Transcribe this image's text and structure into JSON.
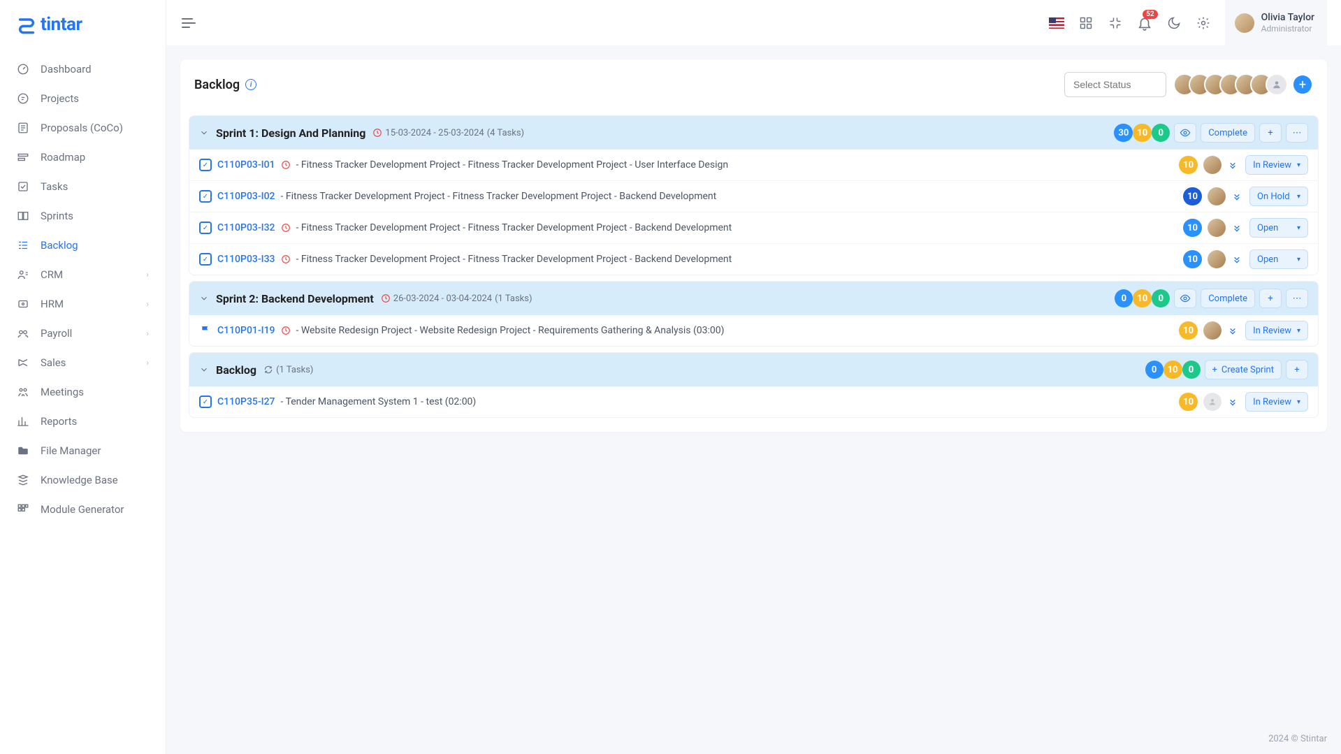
{
  "brand": "tintar",
  "user": {
    "name": "Olivia Taylor",
    "role": "Administrator"
  },
  "notif_count": "52",
  "page": {
    "title": "Backlog",
    "status_placeholder": "Select Status"
  },
  "sidebar": [
    {
      "label": "Dashboard",
      "icon": "gauge"
    },
    {
      "label": "Projects",
      "icon": "project"
    },
    {
      "label": "Proposals (CoCo)",
      "icon": "proposal"
    },
    {
      "label": "Roadmap",
      "icon": "roadmap"
    },
    {
      "label": "Tasks",
      "icon": "tasks"
    },
    {
      "label": "Sprints",
      "icon": "sprints"
    },
    {
      "label": "Backlog",
      "icon": "backlog",
      "active": true
    },
    {
      "label": "CRM",
      "icon": "crm",
      "expandable": true
    },
    {
      "label": "HRM",
      "icon": "hrm",
      "expandable": true
    },
    {
      "label": "Payroll",
      "icon": "payroll",
      "expandable": true
    },
    {
      "label": "Sales",
      "icon": "sales",
      "expandable": true
    },
    {
      "label": "Meetings",
      "icon": "meetings"
    },
    {
      "label": "Reports",
      "icon": "reports"
    },
    {
      "label": "File Manager",
      "icon": "filemgr"
    },
    {
      "label": "Knowledge Base",
      "icon": "kb"
    },
    {
      "label": "Module Generator",
      "icon": "modgen"
    }
  ],
  "avatar_count": 6,
  "sprints": [
    {
      "title": "Sprint 1: Design And Planning",
      "date_range": "15-03-2024 - 25-03-2024",
      "task_count": "(4 Tasks)",
      "pills": [
        {
          "v": "30",
          "c": "blue"
        },
        {
          "v": "10",
          "c": "yellow"
        },
        {
          "v": "0",
          "c": "green"
        }
      ],
      "action_label": "Complete",
      "show_eye": true,
      "show_plus": true,
      "show_more": true,
      "tasks": [
        {
          "code": "C110P03-I01",
          "clock": true,
          "text": " - Fitness Tracker Development Project - Fitness Tracker Development Project - User Interface Design",
          "pill": {
            "v": "10",
            "c": "yellow"
          },
          "avatar": true,
          "status": "In Review"
        },
        {
          "code": "C110P03-I02",
          "clock": false,
          "text": " - Fitness Tracker Development Project - Fitness Tracker Development Project - Backend Development",
          "pill": {
            "v": "10",
            "c": "darkblue"
          },
          "avatar": true,
          "status": "On Hold"
        },
        {
          "code": "C110P03-I32",
          "clock": true,
          "text": " - Fitness Tracker Development Project - Fitness Tracker Development Project - Backend Development",
          "pill": {
            "v": "10",
            "c": "blue"
          },
          "avatar": true,
          "status": "Open"
        },
        {
          "code": "C110P03-I33",
          "clock": true,
          "text": " - Fitness Tracker Development Project - Fitness Tracker Development Project - Backend Development",
          "pill": {
            "v": "10",
            "c": "blue"
          },
          "avatar": true,
          "status": "Open"
        }
      ]
    },
    {
      "title": "Sprint 2: Backend Development",
      "date_range": "26-03-2024 - 03-04-2024",
      "task_count": "(1 Tasks)",
      "pills": [
        {
          "v": "0",
          "c": "blue"
        },
        {
          "v": "10",
          "c": "yellow"
        },
        {
          "v": "0",
          "c": "green"
        }
      ],
      "action_label": "Complete",
      "show_eye": true,
      "show_plus": true,
      "show_more": true,
      "tasks": [
        {
          "icon": "flag",
          "code": "C110P01-I19",
          "clock": true,
          "text": " - Website Redesign Project - Website Redesign Project - Requirements Gathering & Analysis (03:00)",
          "pill": {
            "v": "10",
            "c": "yellow"
          },
          "avatar": true,
          "status": "In Review"
        }
      ]
    },
    {
      "title": "Backlog",
      "is_backlog": true,
      "task_count": "(1 Tasks)",
      "pills": [
        {
          "v": "0",
          "c": "blue"
        },
        {
          "v": "10",
          "c": "yellow"
        },
        {
          "v": "0",
          "c": "green"
        }
      ],
      "action_label": "Create Sprint",
      "action_has_plus": true,
      "show_plus": true,
      "tasks": [
        {
          "code": "C110P35-I27",
          "clock": false,
          "text": " - Tender Management System 1 - test (02:00)",
          "pill": {
            "v": "10",
            "c": "yellow"
          },
          "avatar": "grey",
          "status": "In Review"
        }
      ]
    }
  ],
  "footer": "2024 © Stintar"
}
